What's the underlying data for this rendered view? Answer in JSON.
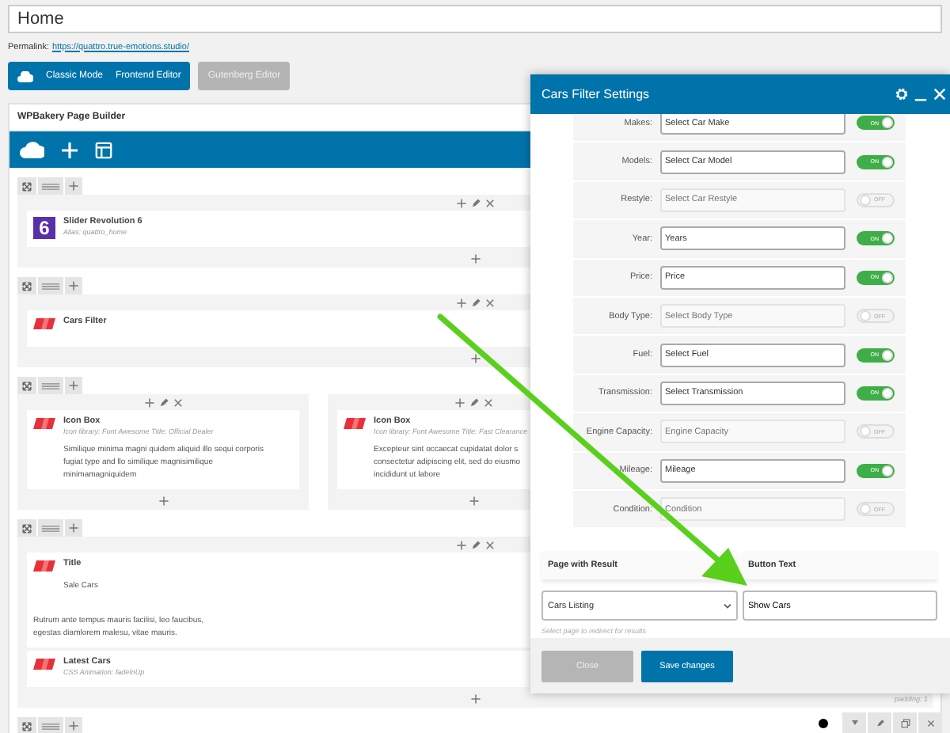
{
  "title_field": {
    "value": "Home"
  },
  "permalink": {
    "label": "Permalink:",
    "url": "https://quattro.true-emotions.studio/"
  },
  "editor_buttons": [
    {
      "label": "Classic Mode",
      "kind": "primary"
    },
    {
      "label": "Frontend Editor",
      "kind": "primary"
    },
    {
      "label": "Gutenberg Editor",
      "kind": "secondary"
    }
  ],
  "builder": {
    "title": "WPBakery Page Builder",
    "rows": [
      {
        "columns": [
          {
            "elements": [
              {
                "kind": "slider",
                "icon_text": "6",
                "title": "Slider Revolution 6",
                "subtitle": "Alias: quattro_home"
              }
            ]
          }
        ]
      },
      {
        "columns": [
          {
            "elements": [
              {
                "kind": "widget",
                "title": "Cars Filter"
              }
            ]
          }
        ]
      },
      {
        "columns": [
          {
            "elements": [
              {
                "kind": "widget",
                "title": "Icon Box",
                "subtitle": "Icon library: Font Awesome  Title: Official Dealer",
                "text": "Similique minima magni quidem aliquid illo sequi corporis\nfugiat type and llo similique magnisimilique\nminimamagniquidem"
              }
            ]
          },
          {
            "elements": [
              {
                "kind": "widget",
                "title": "Icon Box",
                "subtitle": "Icon library: Font Awesome  Title: Fast Clearance",
                "text": "Excepteur sint occaecat cupidatat dolor s\nconsectetur adipiscing elit, sed do eiusmo\nincididunt ut labore"
              }
            ]
          }
        ]
      },
      {
        "columns": [
          {
            "elements": [
              {
                "kind": "widget",
                "title": "Title",
                "text": "Sale Cars",
                "note": "Rutrum ante tempus mauris facilisi, leo faucibus,\negestas diamlorem malesu, vitae mauris."
              },
              {
                "kind": "widget",
                "title": "Latest Cars",
                "subtitle": "CSS Animation: fadeInUp"
              }
            ]
          }
        ]
      },
      {
        "columns": []
      }
    ],
    "padding_note": "padding: 1"
  },
  "modal": {
    "title": "Cars Filter Settings",
    "fields": [
      {
        "label": "Makes:",
        "value": "Select Car Make",
        "on": true,
        "toggle_text": "ON"
      },
      {
        "label": "Models:",
        "value": "Select Car Model",
        "on": true,
        "toggle_text": "ON"
      },
      {
        "label": "Restyle:",
        "placeholder": "Select Car Restyle",
        "on": false,
        "toggle_text": "OFF"
      },
      {
        "label": "Year:",
        "value": "Years",
        "on": true,
        "toggle_text": "ON"
      },
      {
        "label": "Price:",
        "value": "Price",
        "on": true,
        "toggle_text": "ON"
      },
      {
        "label": "Body Type:",
        "placeholder": "Select Body Type",
        "on": false,
        "toggle_text": "OFF"
      },
      {
        "label": "Fuel:",
        "value": "Select Fuel",
        "on": true,
        "toggle_text": "ON"
      },
      {
        "label": "Transmission:",
        "value": "Select Transmission",
        "on": true,
        "toggle_text": "ON"
      },
      {
        "label": "Engine Capacity:",
        "placeholder": "Engine Capacity",
        "on": false,
        "toggle_text": "OFF"
      },
      {
        "label": "Mileage:",
        "value": "Mileage",
        "on": true,
        "toggle_text": "ON"
      },
      {
        "label": "Condition:",
        "placeholder": "Condition",
        "on": false,
        "toggle_text": "OFF"
      }
    ],
    "page_result": {
      "label": "Page with Result",
      "value": "Cars Listing",
      "hint": "Select page to redirect for results"
    },
    "button_text": {
      "label": "Button Text",
      "value": "Show Cars"
    },
    "buttons": [
      {
        "label": "Close",
        "kind": "secondary"
      },
      {
        "label": "Save changes",
        "kind": "primary"
      }
    ]
  }
}
